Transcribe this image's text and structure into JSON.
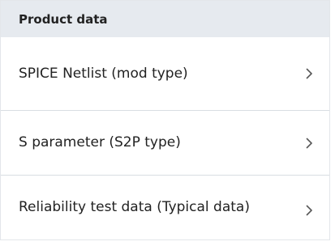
{
  "panel": {
    "title": "Product data"
  },
  "items": [
    {
      "label": "SPICE Netlist (mod type)",
      "icon": "chevron-right-icon"
    },
    {
      "label": "S parameter (S2P type)",
      "icon": "chevron-right-icon"
    },
    {
      "label": "Reliability test data (Typical data)",
      "icon": "chevron-right-icon"
    }
  ],
  "colors": {
    "header_bg": "#e6eaef",
    "divider": "#d9dde2",
    "text": "#222222",
    "chevron": "#555555"
  }
}
